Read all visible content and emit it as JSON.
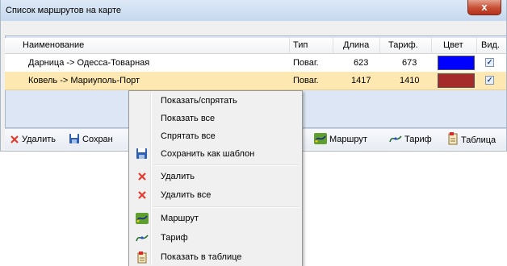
{
  "window": {
    "title": "Список маршрутов на карте",
    "close_label": "x"
  },
  "grid": {
    "columns": [
      "Наименование",
      "Тип",
      "Длина",
      "Тариф.",
      "Цвет",
      "Вид."
    ],
    "rows": [
      {
        "name": "Дарница -> Одесса-Товарная",
        "type": "Поваг.",
        "length": "623",
        "tariff": "673",
        "color": "#0000ff",
        "visible": "✓"
      },
      {
        "name": "Ковель -> Мариуполь-Порт",
        "type": "Поваг.",
        "length": "1417",
        "tariff": "1410",
        "color": "#a52a2a",
        "visible": "✓"
      }
    ]
  },
  "toolbar": {
    "delete_label": "Удалить",
    "save_label": "Сохран",
    "route_label": "Маршрут",
    "tariff_label": "Тариф",
    "table_label": "Таблица"
  },
  "context_menu": {
    "items": [
      {
        "label": "Показать/спрятать",
        "icon": "none"
      },
      {
        "label": "Показать все",
        "icon": "none"
      },
      {
        "label": "Спрятать все",
        "icon": "none"
      },
      {
        "label": "Сохранить как шаблон",
        "icon": "floppy-disk-icon"
      },
      {
        "label": "Удалить",
        "icon": "red-x-icon"
      },
      {
        "label": "Удалить все",
        "icon": "red-x-icon"
      },
      {
        "label": "Маршрут",
        "icon": "route-icon"
      },
      {
        "label": "Тариф",
        "icon": "tariff-icon"
      },
      {
        "label": "Показать в таблице",
        "icon": "table-icon"
      }
    ]
  },
  "colors": {
    "selected_row": "#fce8b0",
    "delete_red": "#e23b2e",
    "menu_bg": "#f0f0f0"
  }
}
